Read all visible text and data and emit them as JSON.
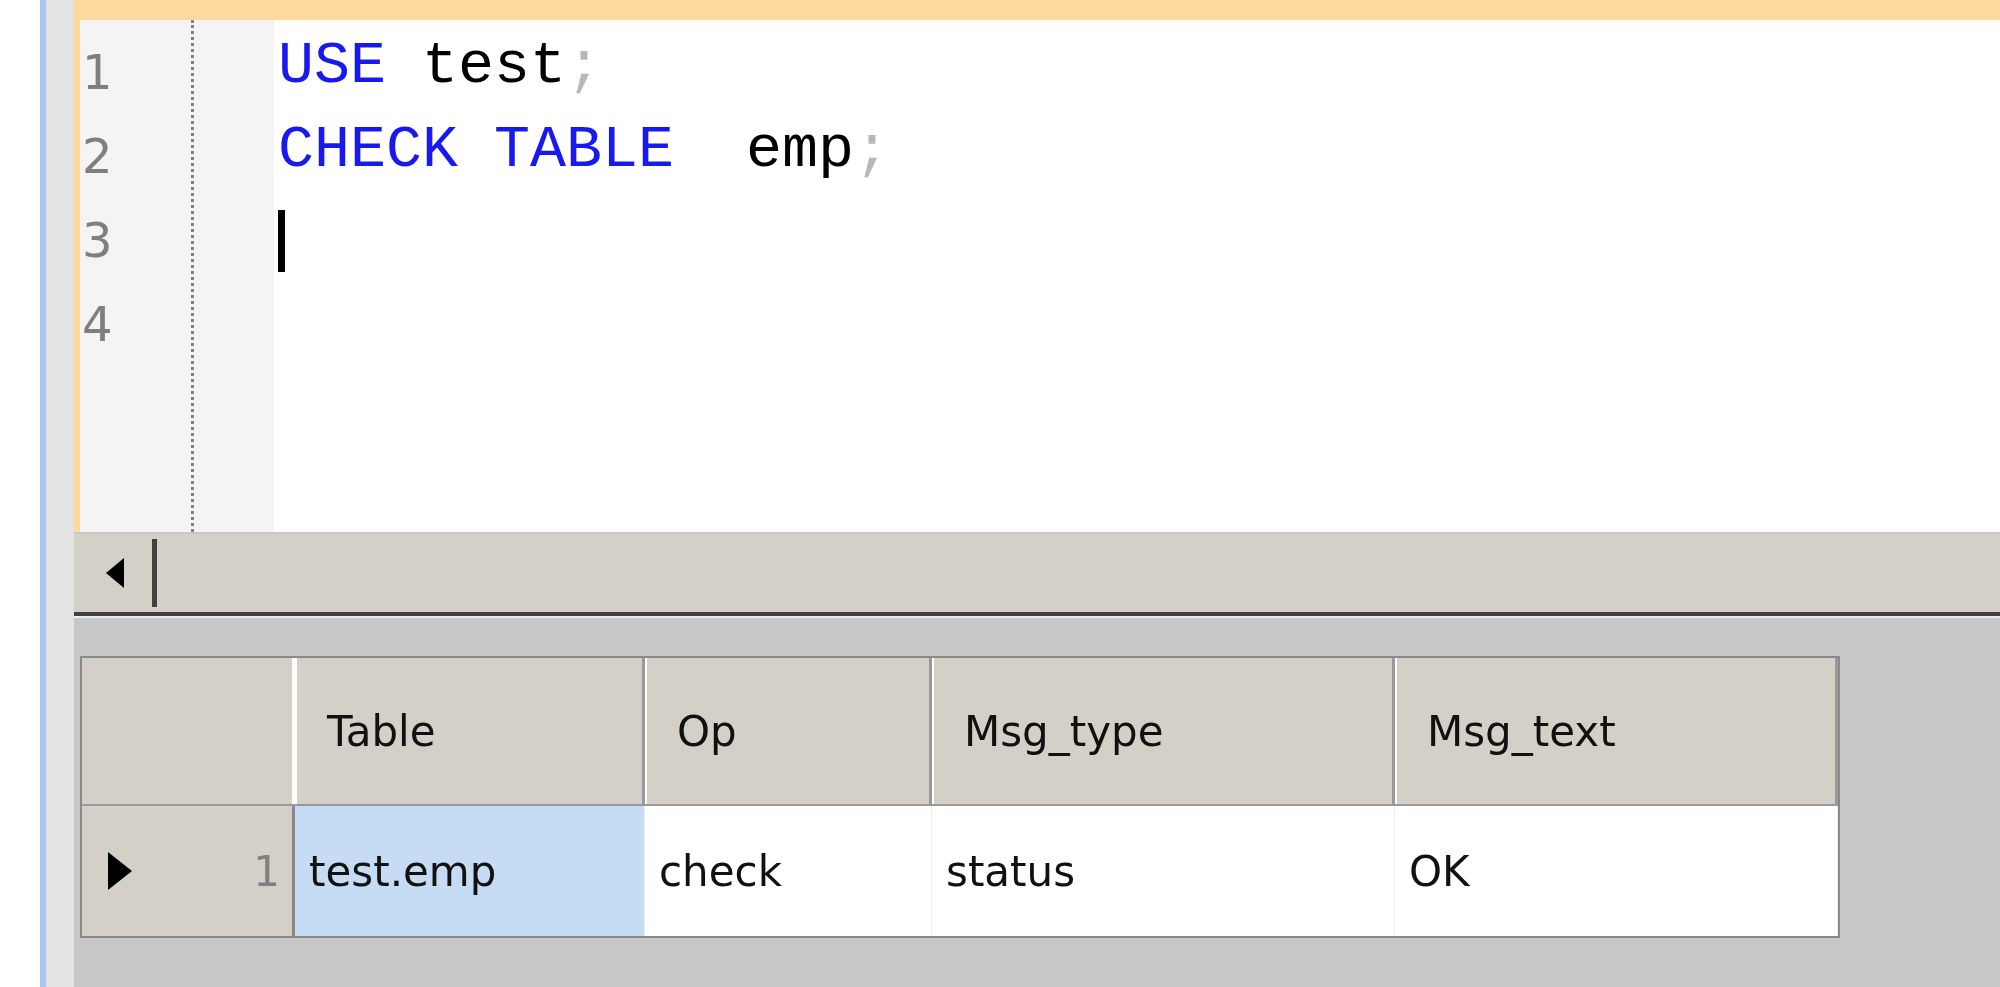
{
  "editor": {
    "lines": [
      {
        "number": "1",
        "caret": false,
        "tokens": [
          {
            "text": "USE",
            "kind": "keyword"
          },
          {
            "text": " test",
            "kind": "ident"
          },
          {
            "text": ";",
            "kind": "punct"
          }
        ]
      },
      {
        "number": "2",
        "caret": false,
        "tokens": [
          {
            "text": "CHECK TABLE",
            "kind": "keyword"
          },
          {
            "text": "  emp",
            "kind": "ident"
          },
          {
            "text": ";",
            "kind": "punct"
          }
        ]
      },
      {
        "number": "3",
        "caret": true
      },
      {
        "number": "4",
        "caret": false
      }
    ]
  },
  "result_grid": {
    "columns": [
      "Table",
      "Op",
      "Msg_type",
      "Msg_text"
    ],
    "rows": [
      {
        "number": "1",
        "current": true,
        "cells": [
          {
            "text": "test.emp",
            "selected": true
          },
          {
            "text": "check",
            "selected": false
          },
          {
            "text": "status",
            "selected": false
          },
          {
            "text": "OK",
            "selected": false
          }
        ]
      }
    ]
  }
}
